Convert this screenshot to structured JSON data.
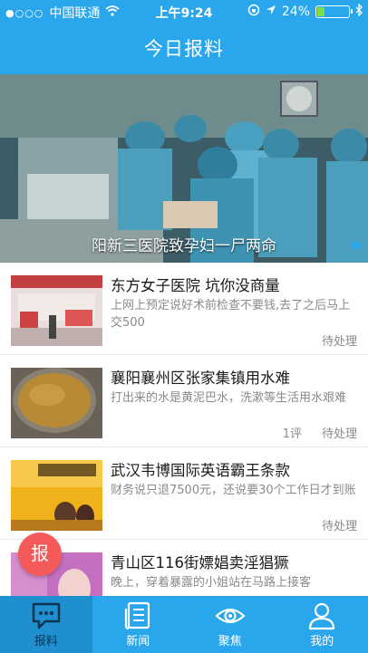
{
  "status_bar": {
    "carrier": "中国联通",
    "signal_dots": "●○○○",
    "time": "上午9:24",
    "battery_percent": "24%",
    "battery_level": 0.24,
    "icons": [
      "wifi-icon",
      "rotation-lock-icon",
      "location-icon",
      "bluetooth-icon"
    ]
  },
  "header": {
    "title": "今日报料"
  },
  "banner": {
    "caption": "阳新三医院致孕妇一尸两命",
    "active_dot_color": "#2aa7ec"
  },
  "news": [
    {
      "title": "东方女子医院 坑你没商量",
      "desc": "上网上预定说好术前检查不要钱,去了之后马上交500",
      "comments": "",
      "status": "待处理"
    },
    {
      "title": "襄阳襄州区张家集镇用水难",
      "desc": "打出来的水是黄泥巴水，洗漱等生活用水艰难",
      "comments": "1评",
      "status": "待处理"
    },
    {
      "title": "武汉韦博国际英语霸王条款",
      "desc": "财务说只退7500元，还说要30个工作日才到账",
      "comments": "",
      "status": "待处理"
    },
    {
      "title": "青山区116街嫖娼卖淫猖獗",
      "desc": "晚上，穿着暴露的小姐站在马路上接客",
      "comments": "",
      "status": ""
    }
  ],
  "report_button": {
    "label": "报"
  },
  "tabs": [
    {
      "label": "报料",
      "icon": "chat-bubble-icon",
      "active": true
    },
    {
      "label": "新闻",
      "icon": "news-document-icon",
      "active": false
    },
    {
      "label": "聚焦",
      "icon": "eye-icon",
      "active": false
    },
    {
      "label": "我的",
      "icon": "person-icon",
      "active": false
    }
  ],
  "colors": {
    "brand": "#2aa7ec",
    "report": "#f45a5a",
    "active_tab": "#1f8fd0"
  }
}
